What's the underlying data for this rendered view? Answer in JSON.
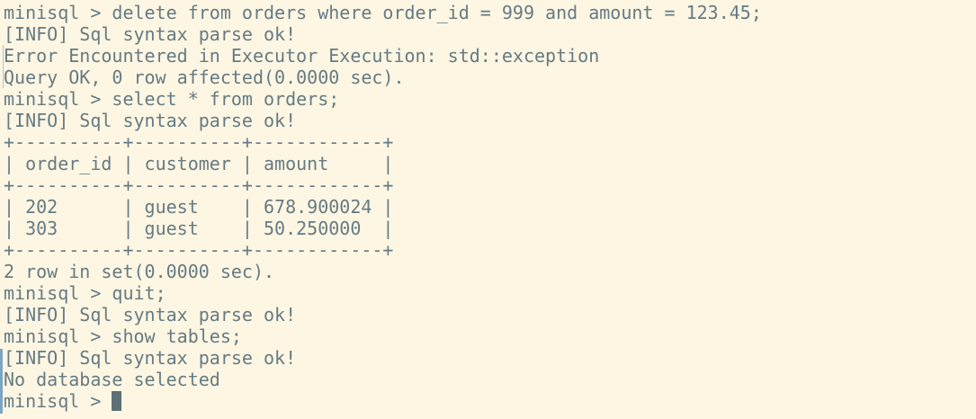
{
  "terminal": {
    "lines": [
      "minisql > delete from orders where order_id = 999 and amount = 123.45;",
      "[INFO] Sql syntax parse ok!",
      "Error Encountered in Executor Execution: std::exception",
      "Query OK, 0 row affected(0.0000 sec).",
      "minisql > select * from orders;",
      "[INFO] Sql syntax parse ok!",
      "+----------+----------+------------+",
      "| order_id | customer | amount     |",
      "+----------+----------+------------+",
      "| 202      | guest    | 678.900024 |",
      "| 303      | guest    | 50.250000  |",
      "+----------+----------+------------+",
      "2 row in set(0.0000 sec).",
      "minisql > quit;",
      "[INFO] Sql syntax parse ok!",
      "minisql > show tables;",
      "[INFO] Sql syntax parse ok!",
      "No database selected"
    ],
    "prompt": "minisql > "
  },
  "colors": {
    "background": "#fdf6e3",
    "foreground": "#657b83",
    "cursor": "#5d7075",
    "scroll_mark": "#7aa6c2"
  }
}
